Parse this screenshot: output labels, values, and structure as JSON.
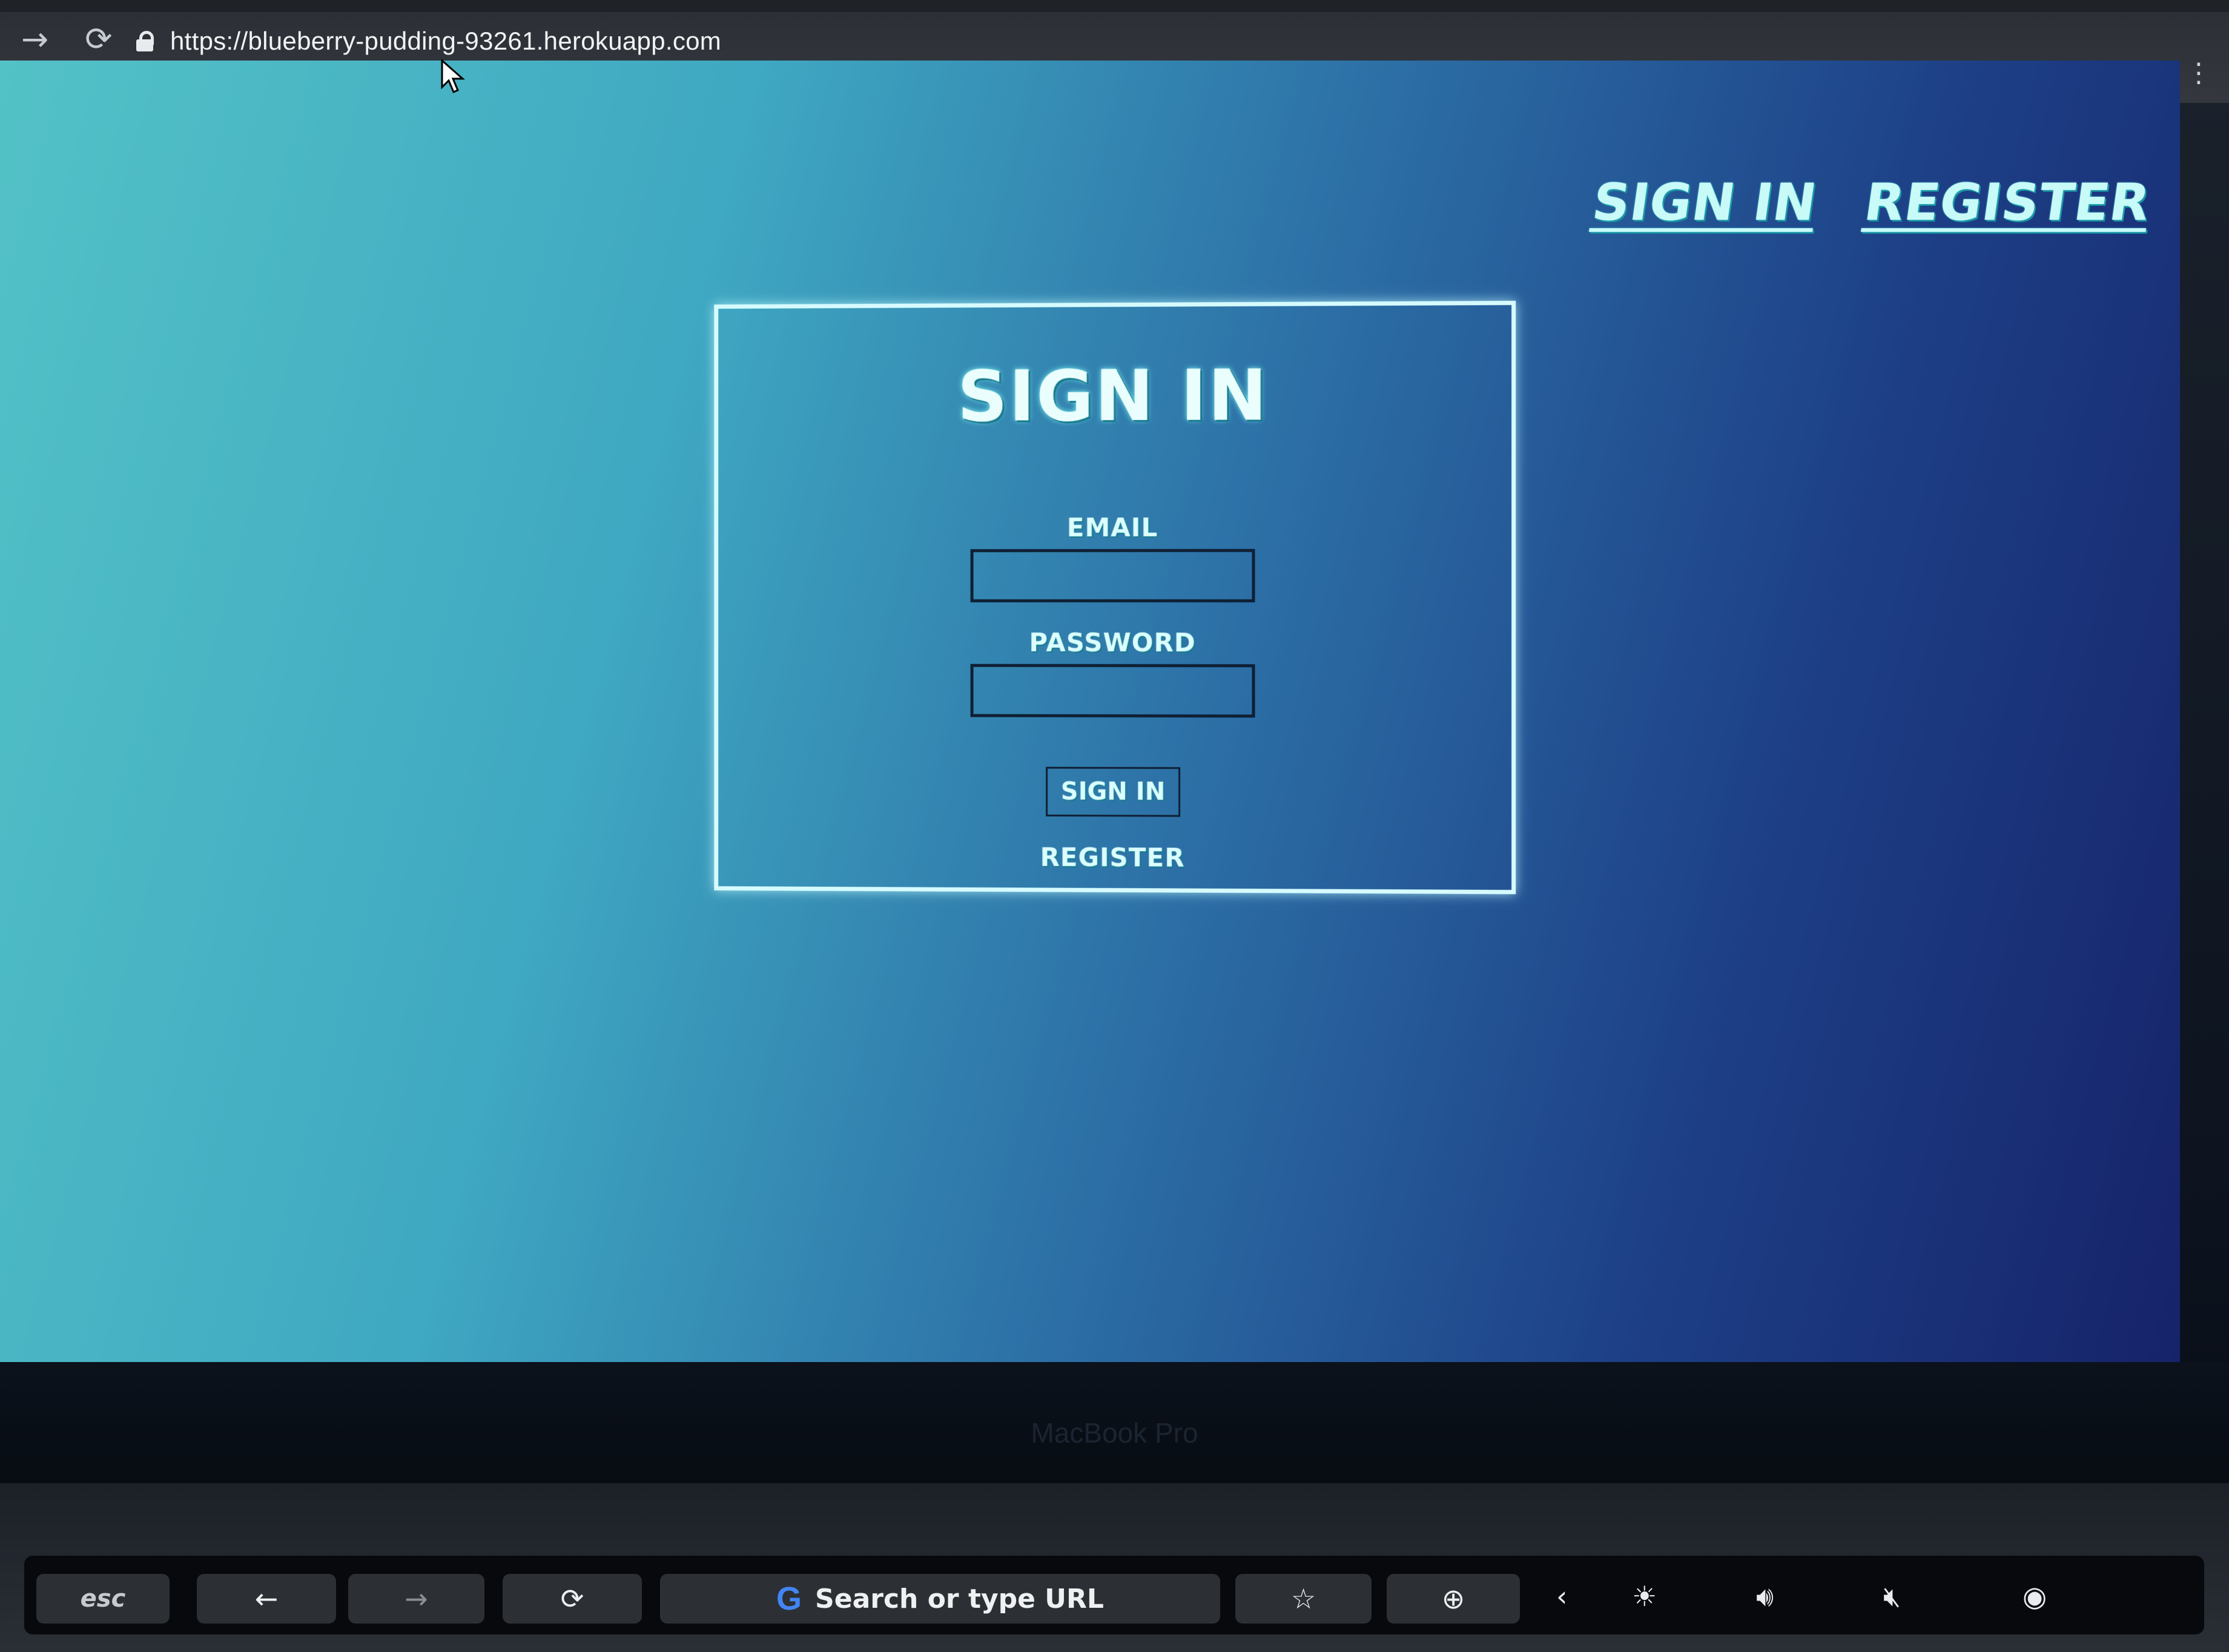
{
  "browser": {
    "url": "https://blueberry-pudding-93261.herokuapp.com",
    "nav_back": "←",
    "nav_forward": "→",
    "reload": "⟳",
    "extensions": [
      {
        "icon": "bookmark-star-icon",
        "color": "#e2e6ea"
      },
      {
        "icon": "extension-arrow-icon",
        "color": "#e85c4a"
      },
      {
        "icon": "extension-red-icon",
        "color": "#e63838"
      },
      {
        "icon": "extension-green-icon",
        "color": "#2db36a"
      },
      {
        "icon": "extension-white-icon",
        "color": "#f2f2f2"
      },
      {
        "icon": "extension-purple-icon",
        "color": "#6e62e6"
      },
      {
        "icon": "extension-violet-check-icon",
        "color": "#8a3fd6"
      },
      {
        "icon": "extension-cube-icon",
        "color": "#cfd3d7"
      },
      {
        "icon": "profile-avatar-icon",
        "color": "#4a4f55"
      }
    ]
  },
  "header": {
    "sign_in": "SIGN IN",
    "register": "REGISTER"
  },
  "form": {
    "title": "SIGN IN",
    "email_label": "EMAIL",
    "email_value": "",
    "password_label": "PASSWORD",
    "password_value": "",
    "submit": "SIGN IN",
    "register_link": "REGISTER"
  },
  "laptop": {
    "brand": "MacBook Pro"
  },
  "touchbar": {
    "esc": "esc",
    "search_placeholder": "Search or type URL",
    "google_glyph": "G"
  },
  "colors": {
    "page_gradient_start": "#53c2c6",
    "page_gradient_end": "#16236a",
    "accent": "#c8faf8",
    "card_border": "#d6fbff"
  }
}
